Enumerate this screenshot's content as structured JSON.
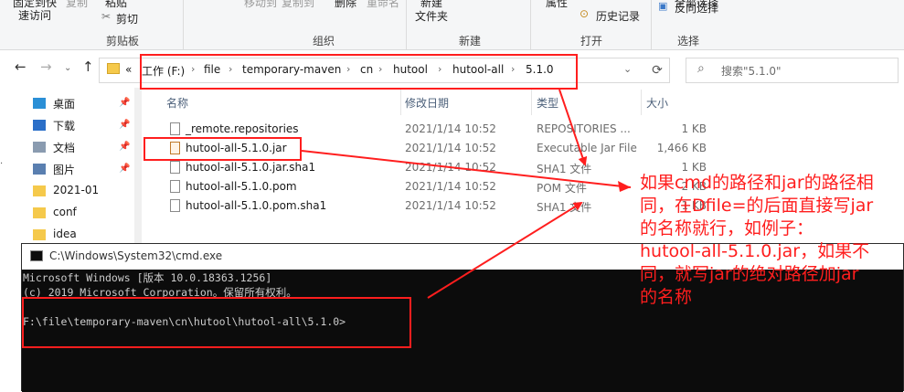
{
  "ribbon": {
    "top_items": [
      {
        "label": "固定到快",
        "faded": false
      },
      {
        "label": "复制",
        "faded": true
      },
      {
        "label": "粘贴",
        "faded": false
      },
      {
        "label": "移动到",
        "faded": true
      },
      {
        "label": "复制到",
        "faded": true
      },
      {
        "label": "删除",
        "faded": false
      },
      {
        "label": "重命名",
        "faded": true
      },
      {
        "label": "新建",
        "faded": false
      },
      {
        "label": "属性",
        "faded": false
      },
      {
        "label": "全部选择",
        "faded": false
      }
    ],
    "quick_access": "速访问",
    "cut": "剪切",
    "folder": "文件夹",
    "history": "历史记录",
    "invert_selection": "反向选择",
    "groups": [
      "剪贴板",
      "组织",
      "新建",
      "打开",
      "选择"
    ]
  },
  "address": {
    "overflow": "«",
    "crumbs": [
      "工作 (F:)",
      "file",
      "temporary-maven",
      "cn",
      "hutool",
      "hutool-all",
      "5.1.0"
    ],
    "refresh_icon": "refresh-icon",
    "search_placeholder": "搜索\"5.1.0\""
  },
  "sidebar": {
    "items": [
      {
        "label": "桌面",
        "pinned": true,
        "icon": "desktop-icon"
      },
      {
        "label": "下载",
        "pinned": true,
        "icon": "download-icon"
      },
      {
        "label": "文档",
        "pinned": true,
        "icon": "documents-icon"
      },
      {
        "label": "图片",
        "pinned": true,
        "icon": "pictures-icon"
      },
      {
        "label": "2021-01",
        "pinned": false,
        "icon": "folder-icon"
      },
      {
        "label": "conf",
        "pinned": false,
        "icon": "folder-icon"
      },
      {
        "label": "idea",
        "pinned": false,
        "icon": "folder-icon"
      }
    ]
  },
  "columns": [
    "名称",
    "修改日期",
    "类型",
    "大小"
  ],
  "files": [
    {
      "name": "_remote.repositories",
      "date": "2021/1/14 10:52",
      "type": "REPOSITORIES ...",
      "size": "1 KB",
      "icon": "file-icon"
    },
    {
      "name": "hutool-all-5.1.0.jar",
      "date": "2021/1/14 10:52",
      "type": "Executable Jar File",
      "size": "1,466 KB",
      "icon": "jar-file-icon"
    },
    {
      "name": "hutool-all-5.1.0.jar.sha1",
      "date": "2021/1/14 10:52",
      "type": "SHA1 文件",
      "size": "1 KB",
      "icon": "file-icon"
    },
    {
      "name": "hutool-all-5.1.0.pom",
      "date": "2021/1/14 10:52",
      "type": "POM 文件",
      "size": "2 KB",
      "icon": "file-icon"
    },
    {
      "name": "hutool-all-5.1.0.pom.sha1",
      "date": "2021/1/14 10:52",
      "type": "SHA1 文件",
      "size": "1 KB",
      "icon": "file-icon"
    }
  ],
  "cmd": {
    "title": "C:\\Windows\\System32\\cmd.exe",
    "lines": [
      "Microsoft Windows [版本 10.0.18363.1256]",
      "(c) 2019 Microsoft Corporation。保留所有权利。",
      "",
      "F:\\file\\temporary-maven\\cn\\hutool\\hutool-all\\5.1.0>"
    ]
  },
  "annotation": {
    "color": "#ff1e1e",
    "lines": [
      "如果cmd的路径和jar的路径相",
      "同，在Dfile=的后面直接写jar",
      "的名称就行，如例子：",
      "hutool-all-5.1.0.jar，如果不",
      "同，就写jar的绝对路径加jar",
      "的名称"
    ]
  }
}
